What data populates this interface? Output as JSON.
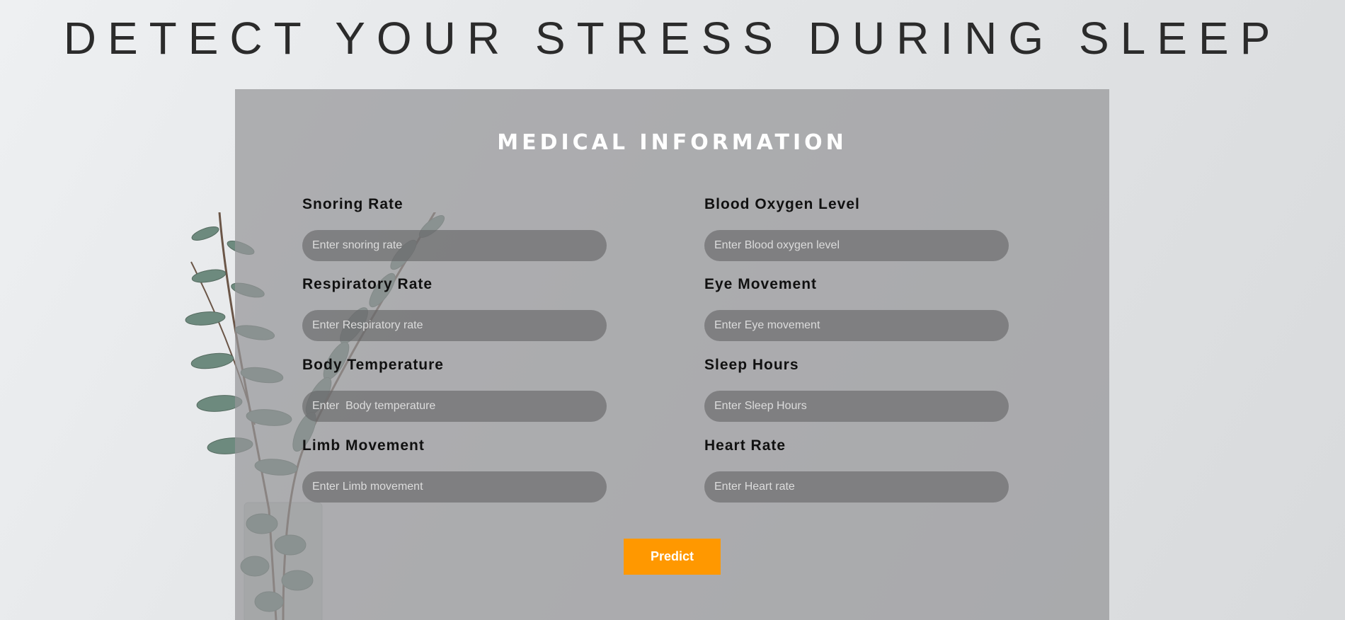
{
  "header": {
    "title": "DETECT YOUR STRESS DURING SLEEP"
  },
  "form": {
    "title": "MEDICAL INFORMATION",
    "fields": {
      "snoring_rate": {
        "label": "Snoring Rate",
        "placeholder": "Enter snoring rate"
      },
      "blood_oxygen": {
        "label": "Blood Oxygen Level",
        "placeholder": "Enter Blood oxygen level"
      },
      "respiratory_rate": {
        "label": "Respiratory Rate",
        "placeholder": "Enter Respiratory rate"
      },
      "eye_movement": {
        "label": "Eye Movement",
        "placeholder": "Enter Eye movement"
      },
      "body_temperature": {
        "label": "Body Temperature",
        "placeholder": "Enter  Body temperature"
      },
      "sleep_hours": {
        "label": "Sleep Hours",
        "placeholder": "Enter Sleep Hours"
      },
      "limb_movement": {
        "label": "Limb Movement",
        "placeholder": "Enter Limb movement"
      },
      "heart_rate": {
        "label": "Heart Rate",
        "placeholder": "Enter Heart rate"
      }
    },
    "submit_label": "Predict"
  },
  "colors": {
    "accent": "#ff9800",
    "card_overlay": "#969698",
    "input_fill": "#646466"
  },
  "decor": {
    "background_image": "eucalyptus-plant-in-glass-vase"
  }
}
